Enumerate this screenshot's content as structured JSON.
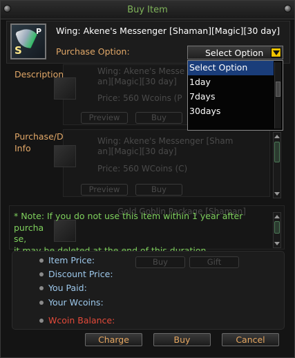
{
  "window": {
    "title": "Buy Item"
  },
  "item": {
    "name": "Wing: Akene's Messenger [Shaman][Magic][30 day]",
    "icon": "wing-item-icon",
    "badge_p": "P",
    "badge_s": "S"
  },
  "purchase": {
    "label": "Purchase Option:",
    "selected": "Select Option",
    "options": [
      "Select Option",
      "1day",
      "7days",
      "30days"
    ]
  },
  "sections": {
    "description_label": "Description",
    "discount_label": "Purchase/Discount Info"
  },
  "background_list": {
    "item1_line1": "Wing: Akene's Messe",
    "item1_line2": "an][Magic][30 day]",
    "item1_price": "Price: 560 Wcoins (P",
    "item1_buttons": [
      "Preview",
      "Buy"
    ],
    "item2_line1": "Wing: Akene's Messenger [Sham",
    "item2_line2": "an][Magic][30 day]",
    "item2_price": "Price: 560 WCoins (C)",
    "item2_buttons": [
      "Preview",
      "Buy"
    ],
    "item3_line1": "Gold Goblin Package [Shaman]",
    "item3_buttons": [
      "Buy",
      "Gift"
    ]
  },
  "note": {
    "lines": [
      "* Note: If you do not use this item within 1 year after purcha",
      "se,",
      "it may be deleted at the end of this duration."
    ]
  },
  "prices": {
    "item_price": "Item Price:",
    "discount_price": "Discount Price:",
    "you_paid": "You Paid:",
    "your_wcoins": "Your Wcoins:",
    "wcoin_balance": "Wcoin Balance:"
  },
  "buttons": {
    "charge": "Charge",
    "buy": "Buy",
    "cancel": "Cancel"
  },
  "colors": {
    "title": "#7fb45a",
    "label_orange": "#e2a868",
    "note_green": "#7fd15d",
    "price_blue": "#9ec9ec",
    "balance_red": "#e44a3a",
    "select_highlight": "#1a3d7a"
  }
}
